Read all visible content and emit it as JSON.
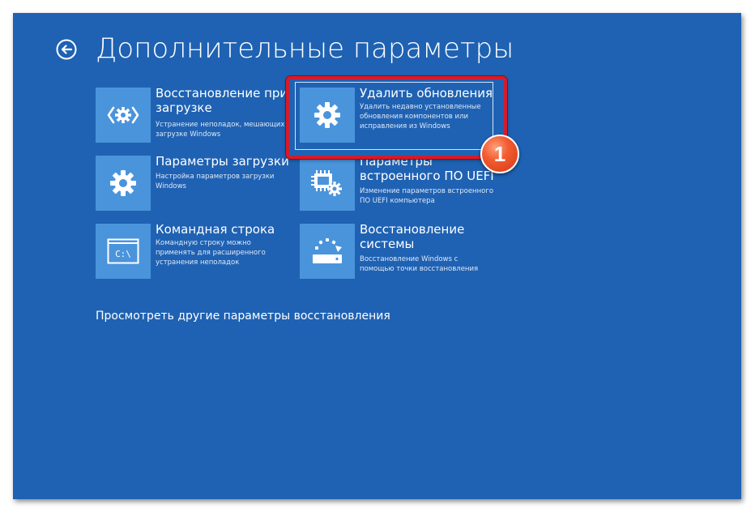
{
  "page": {
    "title": "Дополнительные параметры",
    "back_icon": "back-arrow-icon"
  },
  "tiles": [
    {
      "id": "startup-repair",
      "icon": "startup-repair-icon",
      "title": "Восстановление при загрузке",
      "description": "Устранение неполадок, мешающих загрузке Windows"
    },
    {
      "id": "uninstall-updates",
      "icon": "gear-icon",
      "title": "Удалить обновления",
      "description": "Удалить недавно установленные обновления компонентов или исправления из Windows",
      "selected": true
    },
    {
      "id": "startup-settings",
      "icon": "gear-icon",
      "title": "Параметры загрузки",
      "description": "Настройка параметров загрузки Windows"
    },
    {
      "id": "uefi-firmware",
      "icon": "chip-gear-icon",
      "title": "Параметры встроенного ПО UEFI",
      "description": "Изменение параметров встроенного ПО UEFI компьютера"
    },
    {
      "id": "command-prompt",
      "icon": "command-prompt-icon",
      "title": "Командная строка",
      "description": "Командную строку можно применять для расширенного устранения неполадок"
    },
    {
      "id": "system-restore",
      "icon": "system-restore-icon",
      "title": "Восстановление системы",
      "description": "Восстановление Windows с помощью точки восстановления"
    }
  ],
  "more_options_link": "Просмотреть другие параметры восстановления",
  "annotation": {
    "step": "1",
    "color": "#d41b2c"
  },
  "colors": {
    "background": "#1f62b3",
    "tile_icon_bg": "#4a94dc",
    "text": "#ffffff"
  },
  "command_prompt_glyph": "C:\\"
}
